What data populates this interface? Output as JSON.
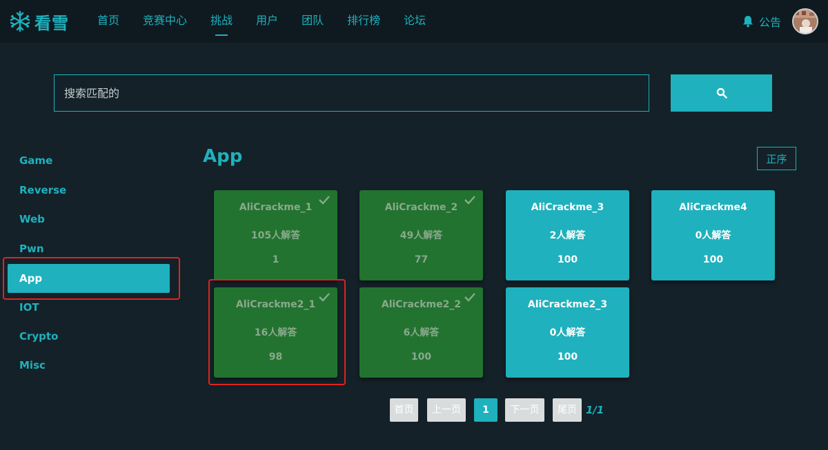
{
  "header": {
    "logo_text": "看雪",
    "nav": [
      {
        "label": "首页",
        "active": false
      },
      {
        "label": "竞赛中心",
        "active": false
      },
      {
        "label": "挑战",
        "active": true
      },
      {
        "label": "用户",
        "active": false
      },
      {
        "label": "团队",
        "active": false
      },
      {
        "label": "排行榜",
        "active": false
      },
      {
        "label": "论坛",
        "active": false
      }
    ],
    "notice_label": "公告"
  },
  "search": {
    "placeholder": "搜索匹配的",
    "button_icon": "search-icon"
  },
  "sidebar": {
    "items": [
      {
        "label": "Game",
        "active": false
      },
      {
        "label": "Reverse",
        "active": false
      },
      {
        "label": "Web",
        "active": false
      },
      {
        "label": "Pwn",
        "active": false
      },
      {
        "label": "App",
        "active": true
      },
      {
        "label": "IOT",
        "active": false
      },
      {
        "label": "Crypto",
        "active": false
      },
      {
        "label": "Misc",
        "active": false
      }
    ]
  },
  "content": {
    "title": "App",
    "sort_label": "正序",
    "challenges": [
      {
        "name": "AliCrackme_1",
        "solves": "105人解答",
        "score": "1",
        "solved": true
      },
      {
        "name": "AliCrackme_2",
        "solves": "49人解答",
        "score": "77",
        "solved": true
      },
      {
        "name": "AliCrackme_3",
        "solves": "2人解答",
        "score": "100",
        "solved": false
      },
      {
        "name": "AliCrackme4",
        "solves": "0人解答",
        "score": "100",
        "solved": false
      },
      {
        "name": "AliCrackme2_1",
        "solves": "16人解答",
        "score": "98",
        "solved": true
      },
      {
        "name": "AliCrackme2_2",
        "solves": "6人解答",
        "score": "100",
        "solved": true
      },
      {
        "name": "AliCrackme2_3",
        "solves": "0人解答",
        "score": "100",
        "solved": false
      }
    ]
  },
  "pagination": {
    "first": "首页",
    "prev": "上一页",
    "current": "1",
    "next": "下一页",
    "last": "尾页",
    "info": "1/1"
  },
  "colors": {
    "accent": "#1fb1bd",
    "solved": "#22732f",
    "background": "#142128",
    "header": "#0e1a20",
    "highlight": "#e3231e"
  }
}
